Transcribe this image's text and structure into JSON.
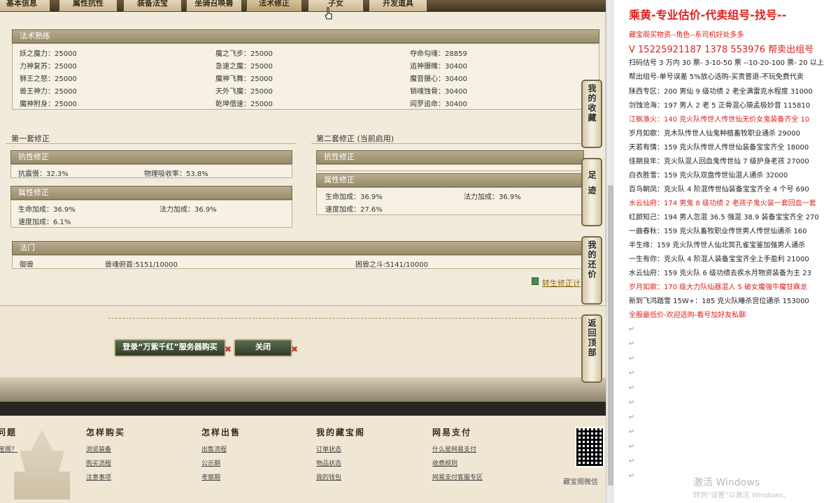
{
  "tabs": [
    "基本信息",
    "属性抗性",
    "装备法宝",
    "坐骑召唤兽",
    "法术修正",
    "子女",
    "开发道具"
  ],
  "skills": {
    "title": "法术熟练",
    "col1": [
      "妖之魔力：25000",
      "力神复苏：25000",
      "狮王之怒：25000",
      "兽王神力：25000",
      "魔神附身：25000"
    ],
    "col2": [
      "魔之飞步：25000",
      "急速之魔：25000",
      "魔神飞舞：25000",
      "天外飞魔：25000",
      "乾坤借速：25000"
    ],
    "col3": [
      "夺命勾魂：28859",
      "追神摄魄：30400",
      "魔音摄心：30400",
      "销魂蚀骨：30400",
      "阎罗追命：30400"
    ]
  },
  "set1": {
    "title": "第一套修正",
    "resist_title": "抗性修正",
    "resist": [
      "抗震慑：32.3%",
      "物理吸收率：53.8%"
    ],
    "attr_title": "属性修正",
    "attr": [
      "生命加成：36.9%",
      "法力加成：36.9%",
      "速度加成：6.1%"
    ]
  },
  "set2": {
    "title": "第二套修正 (当前启用)",
    "resist_title": "抗性修正",
    "attr_title": "属性修正",
    "attr": [
      "生命加成：36.9%",
      "法力加成：36.9%",
      "速度加成：27.6%"
    ]
  },
  "sect": {
    "title": "法门",
    "items": [
      "御兽",
      "兽魂俯首:5151/10000",
      "困兽之斗:5141/10000"
    ]
  },
  "rebirth_link": "转生修正计",
  "buttons": {
    "login": "登录“万紫千红”服务器购买",
    "close": "关闭"
  },
  "side_buttons": [
    "我的收藏",
    "足迹",
    "我的还价",
    "返回顶部"
  ],
  "footer": {
    "columns": [
      {
        "title": "问题",
        "links": [
          "宝阁？"
        ]
      },
      {
        "title": "怎样购买",
        "links": [
          "浏览装备",
          "购买流程",
          "注意事项"
        ]
      },
      {
        "title": "怎样出售",
        "links": [
          "出售流程",
          "公示期",
          "考察期"
        ]
      },
      {
        "title": "我的藏宝阁",
        "links": [
          "订单状态",
          "物品状态",
          "我的钱包"
        ]
      },
      {
        "title": "网易支付",
        "links": [
          "什么是网易支付",
          "收费规则",
          "网易支付客服专区"
        ]
      }
    ],
    "qr_label": "藏宝阁微信"
  },
  "doc": {
    "title": "乘黄-专业估价-代卖组号-找号--",
    "lines": [
      {
        "text": "藏宝阁买物资--角色--系司机好处多多",
        "style": "red"
      },
      {
        "text": "V 15225921187  1378 553976 帮卖出组号",
        "style": "mid"
      },
      {
        "text": "扫码估号 3 万内 30 票- 3-10-50 票  --10-20-100 票- 20 以上",
        "style": ""
      },
      {
        "text": "帮出组号-单号误差 5%放心选购-买贵嘗退-不玩免费代卖",
        "style": ""
      },
      {
        "text": "陕西专区：200 男仙 9 级功绩 2 老全满雷克水程度 31000",
        "style": ""
      },
      {
        "text": "剑蚀沧海：197 男人 2 老 5 正骨混心猿孟极妙音 115810",
        "style": ""
      },
      {
        "text": "江枫渔火：140 克火队传世人传世仙无价女鬼装备齐全 10",
        "style": "red"
      },
      {
        "text": "岁月如歌：克木队传世人仙鬼种植畜牧职业通杀 29000",
        "style": ""
      },
      {
        "text": "天若有情：159 克火队传世人传世仙装备宝宝齐全 18000",
        "style": ""
      },
      {
        "text": "佳期良年：克火队混人回血鬼传世仙 7 级护身老孩 27000",
        "style": ""
      },
      {
        "text": "白衣胜雪：159 克火队双盘传世仙混人通杀 32000",
        "style": ""
      },
      {
        "text": "百鸟朝凤：克火队 4 阶混传世仙装备宝宝齐全 4 个号 690",
        "style": ""
      },
      {
        "text": "水云仙府：174 男鬼 8 级功绩 2 老孩子鬼火装一套回血一套",
        "style": "red"
      },
      {
        "text": "红颜知己：194 男人忽混 36.5 强混 38.9 装备宝宝齐全 270",
        "style": ""
      },
      {
        "text": "一曲春秋：159 克火队畜牧职业传世男人传世仙通杀 160",
        "style": ""
      },
      {
        "text": "半生缘：159 克火队传世人仙北冥孔雀宝鉴加强男人通杀",
        "style": ""
      },
      {
        "text": "一生有你：克火队 4 阶混人装备宝宝齐全上手盈利 21000",
        "style": ""
      },
      {
        "text": "水云仙府：159 克火队 6 级功绩去疾水月物资装备为主 23",
        "style": ""
      },
      {
        "text": "岁月如歌：170 级大力队仙器混人 5 破女魔强牛魔甘霖龙",
        "style": "red"
      },
      {
        "text": "新到飞鸿踏雪 15W+：185 克火队睡杀宫位通杀 153000",
        "style": ""
      },
      {
        "text": "全服最低价-欢迎选购-看号加好友私聊",
        "style": "red"
      }
    ],
    "watermark": "激活 Windows",
    "watermark_sub": "转到“设置”以激活 Windows。"
  }
}
